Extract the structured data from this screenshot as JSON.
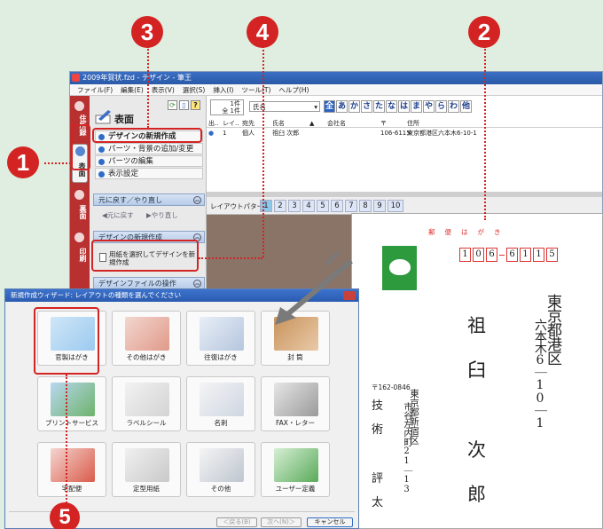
{
  "window": {
    "title": "2009年賀状.fzd - デザイン - 筆王",
    "menu": [
      "ファイル(F)",
      "編集(E)",
      "表示(V)",
      "選択(S)",
      "挿入(I)",
      "ツール(T)",
      "ヘルプ(H)"
    ]
  },
  "side_tabs": [
    "住所録",
    "表面",
    "裏面",
    "印刷"
  ],
  "left_panel": {
    "heading": "表面",
    "toolbar_icons": [
      "refresh-icon",
      "page-icon",
      "help-icon"
    ],
    "help_glyph": "?",
    "menu_items": [
      "デザインの新規作成",
      "パーツ・背景の追加/変更",
      "パーツの編集",
      "表示設定"
    ],
    "undo_section": {
      "title": "元に戻す／やり直し",
      "undo": "元に戻す",
      "redo": "やり直し"
    },
    "new_design_section": {
      "title": "デザインの新規作成",
      "item": "用紙を選択してデザインを新規作成"
    },
    "file_section": {
      "title": "デザインファイルの操作"
    }
  },
  "address_list": {
    "counter_top": "1件",
    "counter_bottom": "全 1件",
    "sort_field": "氏名",
    "kana_buttons": [
      "全",
      "あ",
      "か",
      "さ",
      "た",
      "な",
      "は",
      "ま",
      "や",
      "ら",
      "わ",
      "他"
    ],
    "columns": [
      "出..",
      "レイ..",
      "宛先",
      "氏名",
      "▲",
      "会社名",
      "〒",
      "住所"
    ],
    "row": {
      "out": "1",
      "dest": "個人",
      "name": "祖臼 次郎",
      "zip": "106-6115",
      "address": "東京都港区六本木6-10-1"
    }
  },
  "layout_bar": {
    "label": "レイアウトパターン",
    "patterns": [
      "1",
      "2",
      "3",
      "4",
      "5",
      "6",
      "7",
      "8",
      "9",
      "10"
    ],
    "selected": "1"
  },
  "postcard": {
    "header": "郵便はがき",
    "zip_digits": [
      "1",
      "0",
      "6",
      "6",
      "1",
      "1",
      "5"
    ],
    "recipient_address_line1": "東京都港区",
    "recipient_address_line2": "六本木6｜10｜1",
    "recipient_name": [
      "祖",
      "臼",
      "次",
      "郎"
    ],
    "sender_zip": "〒162-0846",
    "sender_address_line1": "東京都新宿区",
    "sender_address_line2": "市谷左内町21｜13",
    "sender_name": [
      "技",
      "術",
      "評",
      "太"
    ]
  },
  "wizard": {
    "title": "新規作成ウィザード: レイアウトの種類を選んでください",
    "tiles": [
      "官製はがき",
      "その他はがき",
      "往復はがき",
      "封 筒",
      "プリントサービス",
      "ラベルシール",
      "名刺",
      "FAX・レター",
      "宅配便",
      "定型用紙",
      "その他",
      "ユーザー定義"
    ],
    "buttons": {
      "back": "＜戻る(B)",
      "next": "次へ(N)＞",
      "cancel": "キャンセル"
    }
  },
  "annotations": [
    "1",
    "2",
    "3",
    "4",
    "5"
  ],
  "colors": {
    "accent_red": "#d42323",
    "title_blue": "#2b5bb0",
    "stamp_green": "#2e9a3e"
  }
}
